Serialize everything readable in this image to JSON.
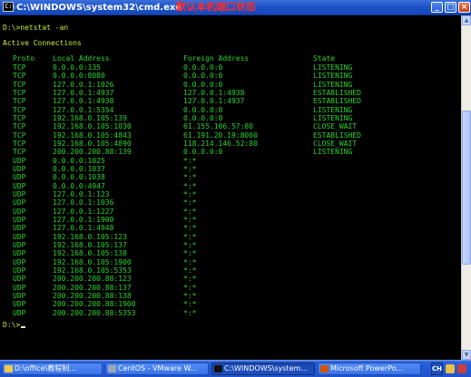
{
  "window": {
    "title": "C:\\WINDOWS\\system32\\cmd.exe",
    "annotation": "默认本机端口状态",
    "minimize_glyph": "_",
    "maximize_glyph": "□",
    "close_glyph": "×",
    "icon_label": "C:\\"
  },
  "console": {
    "command_line": "D:\\>netstat -an",
    "section_title": "Active Connections",
    "headers": {
      "proto": "Proto",
      "local": "Local Address",
      "foreign": "Foreign Address",
      "state": "State"
    },
    "rows": [
      {
        "proto": "TCP",
        "local": "0.0.0.0:135",
        "foreign": "0.0.0.0:0",
        "state": "LISTENING"
      },
      {
        "proto": "TCP",
        "local": "0.0.0.0:8080",
        "foreign": "0.0.0.0:0",
        "state": "LISTENING"
      },
      {
        "proto": "TCP",
        "local": "127.0.0.1:1026",
        "foreign": "0.0.0.0:0",
        "state": "LISTENING"
      },
      {
        "proto": "TCP",
        "local": "127.0.0.1:4937",
        "foreign": "127.0.0.1:4938",
        "state": "ESTABLISHED"
      },
      {
        "proto": "TCP",
        "local": "127.0.0.1:4938",
        "foreign": "127.0.0.1:4937",
        "state": "ESTABLISHED"
      },
      {
        "proto": "TCP",
        "local": "127.0.0.1:5354",
        "foreign": "0.0.0.0:0",
        "state": "LISTENING"
      },
      {
        "proto": "TCP",
        "local": "192.168.0.105:139",
        "foreign": "0.0.0.0:0",
        "state": "LISTENING"
      },
      {
        "proto": "TCP",
        "local": "192.168.0.105:1030",
        "foreign": "61.155.106.57:80",
        "state": "CLOSE_WAIT"
      },
      {
        "proto": "TCP",
        "local": "192.168.0.105:4843",
        "foreign": "61.191.20.19:8000",
        "state": "ESTABLISHED"
      },
      {
        "proto": "TCP",
        "local": "192.168.0.105:4890",
        "foreign": "118.214.146.52:80",
        "state": "CLOSE_WAIT"
      },
      {
        "proto": "TCP",
        "local": "200.200.200.88:139",
        "foreign": "0.0.0.0:0",
        "state": "LISTENING"
      },
      {
        "proto": "UDP",
        "local": "0.0.0.0:1025",
        "foreign": "*:*",
        "state": ""
      },
      {
        "proto": "UDP",
        "local": "0.0.0.0:1037",
        "foreign": "*:*",
        "state": ""
      },
      {
        "proto": "UDP",
        "local": "0.0.0.0:1038",
        "foreign": "*:*",
        "state": ""
      },
      {
        "proto": "UDP",
        "local": "0.0.0.0:4947",
        "foreign": "*:*",
        "state": ""
      },
      {
        "proto": "UDP",
        "local": "127.0.0.1:123",
        "foreign": "*:*",
        "state": ""
      },
      {
        "proto": "UDP",
        "local": "127.0.0.1:1036",
        "foreign": "*:*",
        "state": ""
      },
      {
        "proto": "UDP",
        "local": "127.0.0.1:1227",
        "foreign": "*:*",
        "state": ""
      },
      {
        "proto": "UDP",
        "local": "127.0.0.1:1900",
        "foreign": "*:*",
        "state": ""
      },
      {
        "proto": "UDP",
        "local": "127.0.0.1:4948",
        "foreign": "*:*",
        "state": ""
      },
      {
        "proto": "UDP",
        "local": "192.168.0.105:123",
        "foreign": "*:*",
        "state": ""
      },
      {
        "proto": "UDP",
        "local": "192.168.0.105:137",
        "foreign": "*:*",
        "state": ""
      },
      {
        "proto": "UDP",
        "local": "192.168.0.105:138",
        "foreign": "*:*",
        "state": ""
      },
      {
        "proto": "UDP",
        "local": "192.168.0.105:1900",
        "foreign": "*:*",
        "state": ""
      },
      {
        "proto": "UDP",
        "local": "192.168.0.105:5353",
        "foreign": "*:*",
        "state": ""
      },
      {
        "proto": "UDP",
        "local": "200.200.200.88:123",
        "foreign": "*:*",
        "state": ""
      },
      {
        "proto": "UDP",
        "local": "200.200.200.88:137",
        "foreign": "*:*",
        "state": ""
      },
      {
        "proto": "UDP",
        "local": "200.200.200.88:138",
        "foreign": "*:*",
        "state": ""
      },
      {
        "proto": "UDP",
        "local": "200.200.200.88:1900",
        "foreign": "*:*",
        "state": ""
      },
      {
        "proto": "UDP",
        "local": "200.200.200.88:5353",
        "foreign": "*:*",
        "state": ""
      }
    ],
    "prompt": "D:\\>"
  },
  "taskbar": {
    "items": [
      {
        "label": "D:\\office\\教程制...",
        "icon": "folder-icon",
        "icon_color": "#f2c94c"
      },
      {
        "label": "CentOS - VMware W...",
        "icon": "vmware-icon",
        "icon_color": "#9aa7b8"
      },
      {
        "label": "C:\\WINDOWS\\system...",
        "icon": "cmd-icon",
        "icon_color": "#111111"
      },
      {
        "label": "Microsoft PowerPo...",
        "icon": "powerpoint-icon",
        "icon_color": "#d35400"
      }
    ],
    "lang": "CH"
  },
  "colors": {
    "console_bg": "#000000",
    "console_text": "#2ad42a",
    "prompt_text": "#c8ee2a",
    "annotation": "#ff2a2a"
  }
}
